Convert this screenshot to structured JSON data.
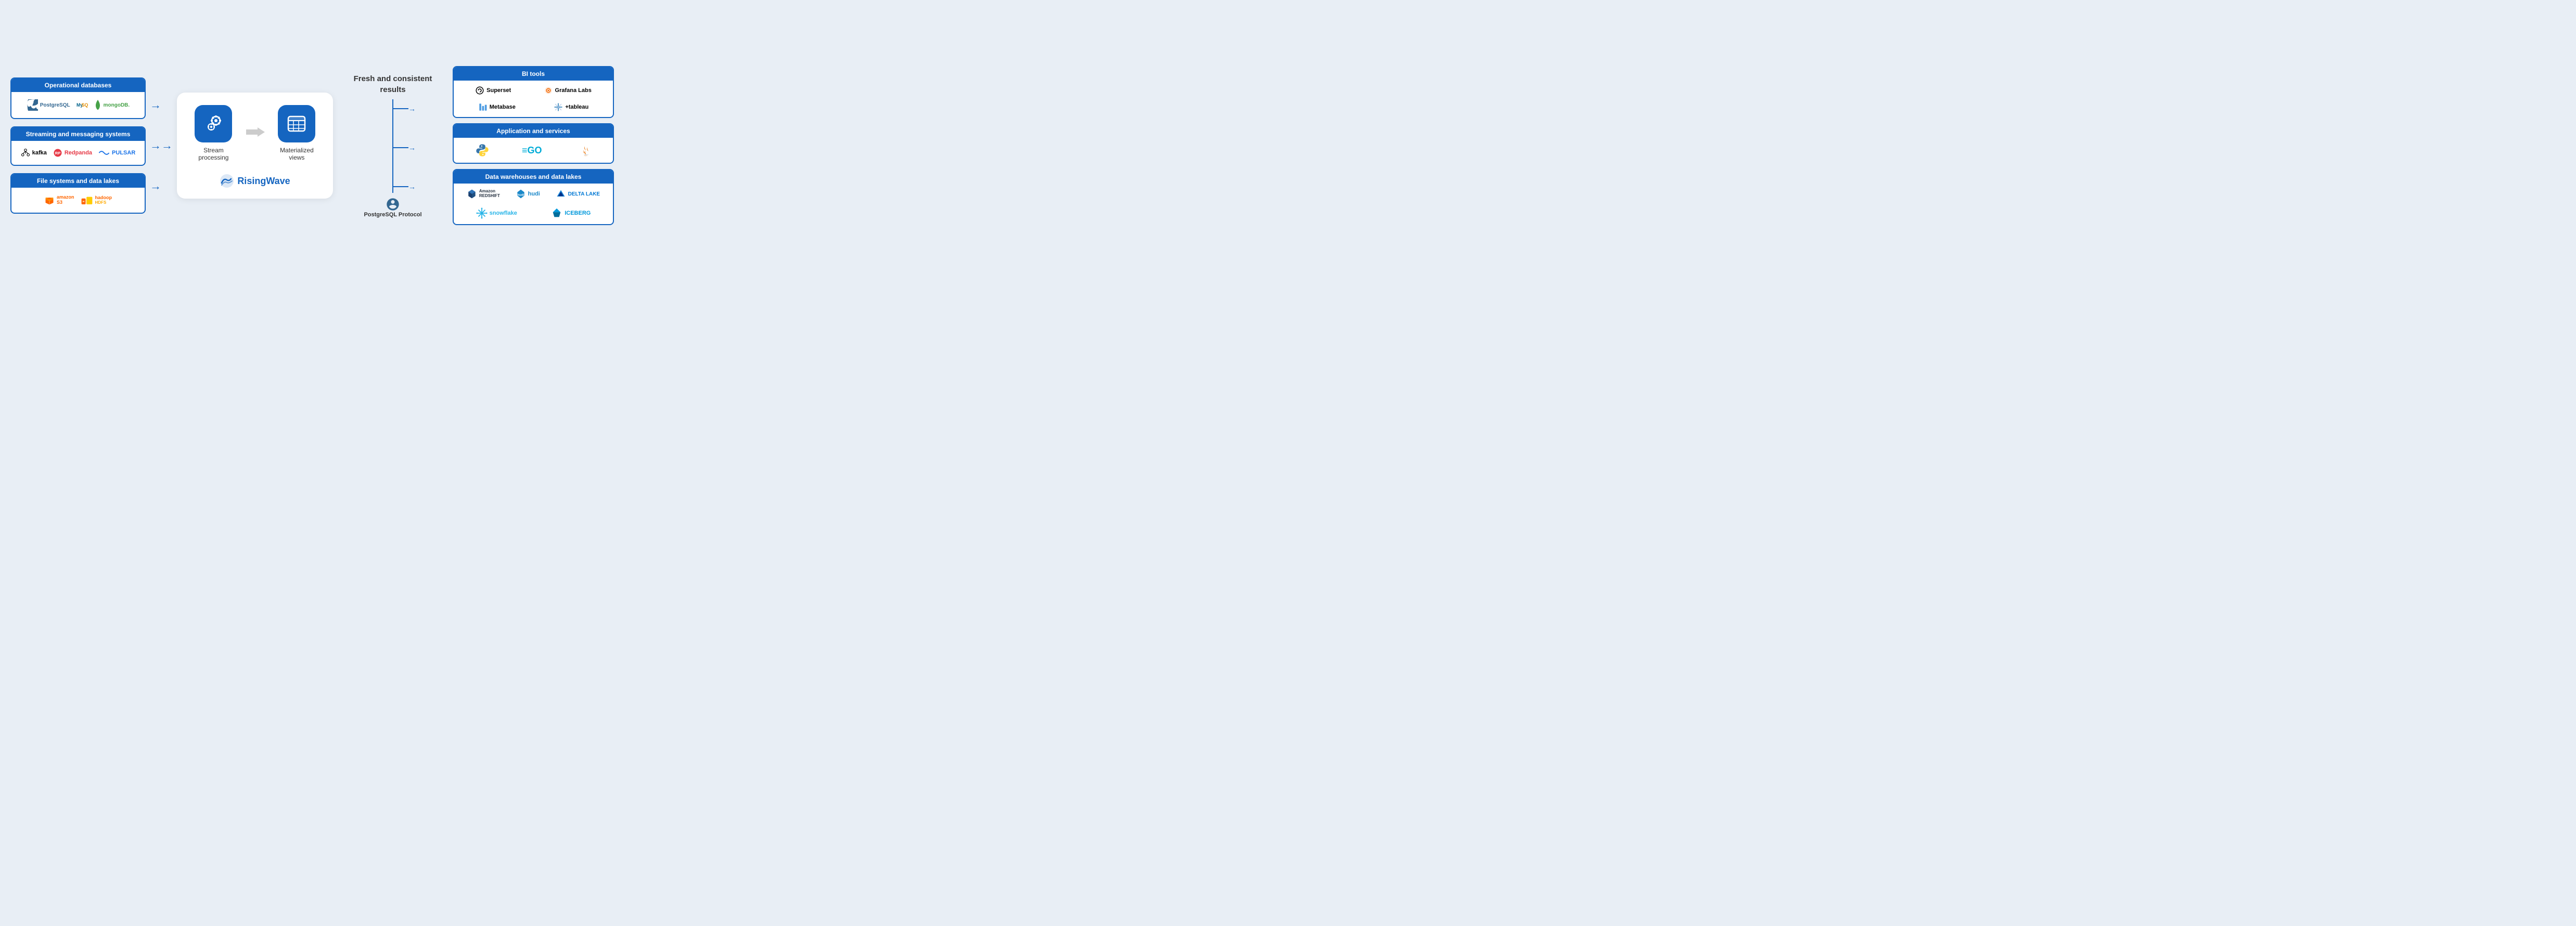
{
  "left": {
    "operational": {
      "header": "Operational databases",
      "logos": [
        "PostgreSQL",
        "MySQL",
        "mongoDB"
      ]
    },
    "streaming": {
      "header": "Streaming and messaging systems",
      "logos": [
        "kafka",
        "Redpanda",
        "PULSAR"
      ]
    },
    "filesystems": {
      "header": "File systems and data lakes",
      "logos": [
        "amazon S3",
        "hadoop HDFS"
      ]
    }
  },
  "center": {
    "stream_processing_label": "Stream processing",
    "materialized_views_label": "Materialized views",
    "brand_name": "RisingWave"
  },
  "middle": {
    "fresh_results": "Fresh and consistent results",
    "pg_protocol": "PostgreSQL Protocol"
  },
  "right": {
    "bi_tools": {
      "header": "BI tools",
      "row1": [
        "Superset",
        "Grafana Labs"
      ],
      "row2": [
        "Metabase",
        "+tableau"
      ]
    },
    "app_services": {
      "header": "Application and services",
      "logos": [
        "Python",
        "GO",
        "Java"
      ]
    },
    "data_warehouses": {
      "header": "Data warehouses and data lakes",
      "row1": [
        "Amazon Redshift",
        "hudi",
        "DELTA LAKE"
      ],
      "row2": [
        "snowflake",
        "ICEBERG"
      ]
    }
  }
}
